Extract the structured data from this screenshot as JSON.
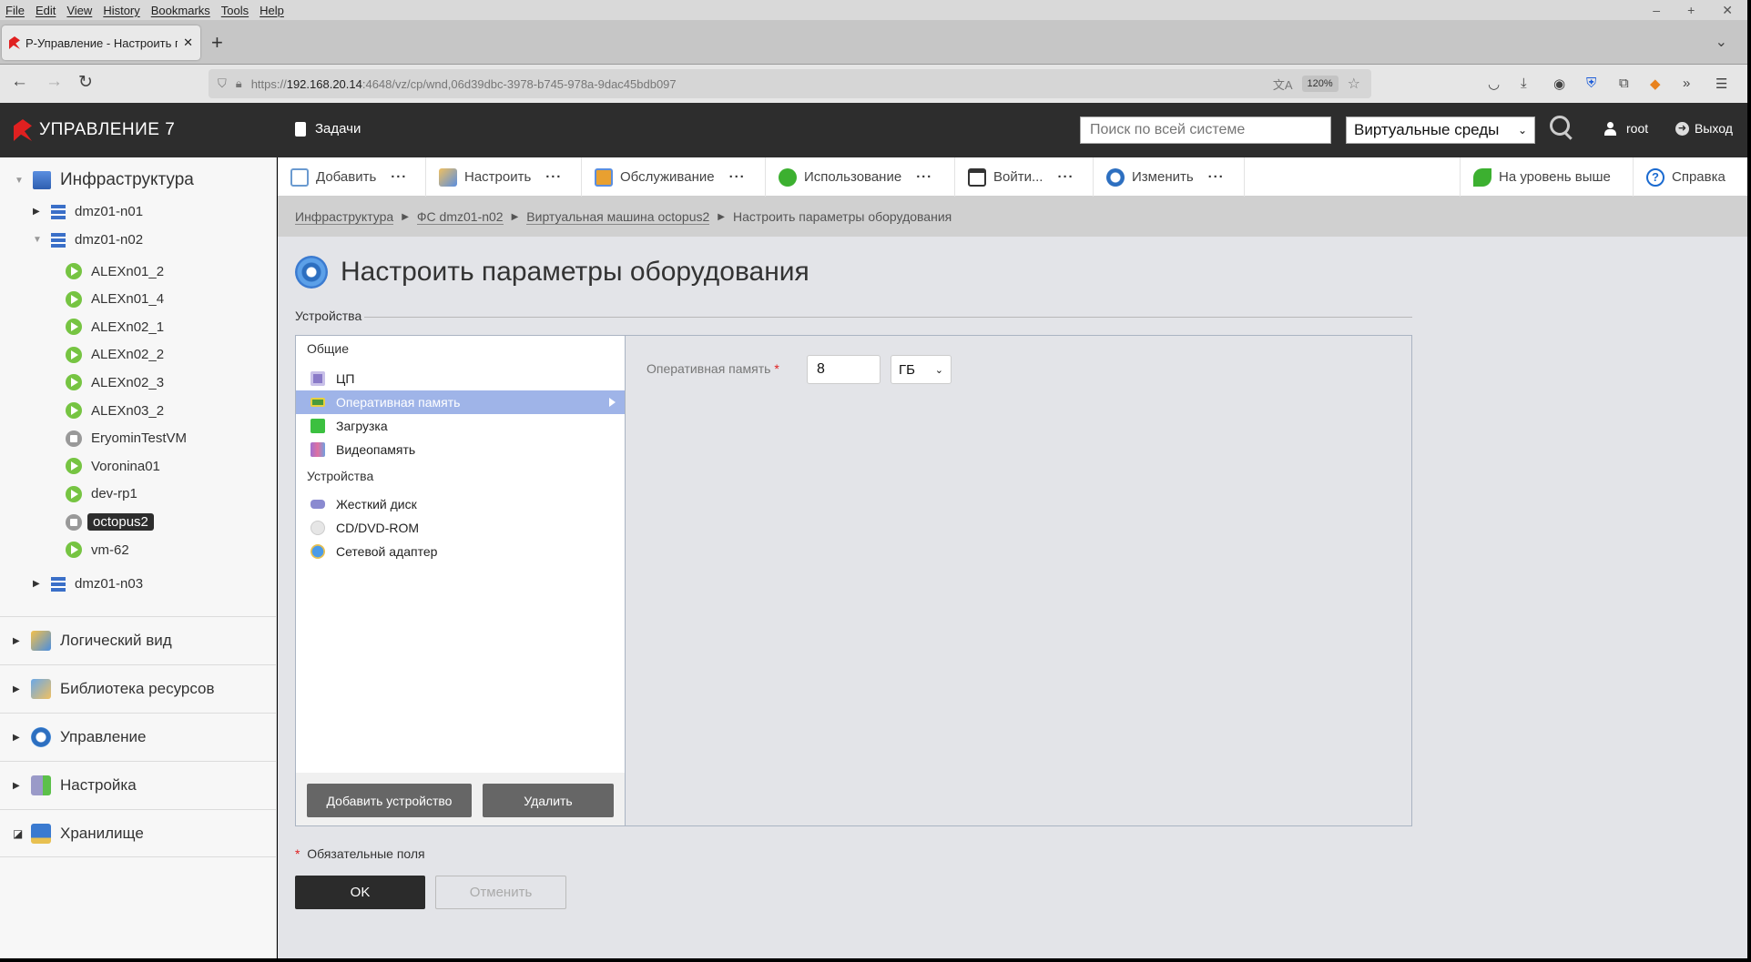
{
  "browser": {
    "menu": [
      "File",
      "Edit",
      "View",
      "History",
      "Bookmarks",
      "Tools",
      "Help"
    ],
    "tab_title": "Р-Управление - Настроить па",
    "url_prefix": "https://",
    "url_host": "192.168.20.14",
    "url_rest": ":4648/vz/cp/wnd,06d39dbc-3978-b745-978a-9dac45bdb097",
    "zoom": "120%"
  },
  "header": {
    "logo": "УПРАВЛЕНИЕ 7",
    "tasks": "Задачи",
    "search_placeholder": "Поиск по всей системе",
    "env_select": "Виртуальные среды",
    "user": "root",
    "logout": "Выход"
  },
  "sidebar": {
    "root": "Инфраструктура",
    "nodes": [
      "dmz01-n01",
      "dmz01-n02",
      "dmz01-n03"
    ],
    "vms": [
      {
        "name": "ALEXn01_2",
        "state": "running"
      },
      {
        "name": "ALEXn01_4",
        "state": "running"
      },
      {
        "name": "ALEXn02_1",
        "state": "running"
      },
      {
        "name": "ALEXn02_2",
        "state": "running"
      },
      {
        "name": "ALEXn02_3",
        "state": "running"
      },
      {
        "name": "ALEXn03_2",
        "state": "running"
      },
      {
        "name": "EryominTestVM",
        "state": "stopped"
      },
      {
        "name": "Voronina01",
        "state": "running"
      },
      {
        "name": "dev-rp1",
        "state": "running"
      },
      {
        "name": "octopus2",
        "state": "stopped"
      },
      {
        "name": "vm-62",
        "state": "running"
      }
    ],
    "sections": [
      "Логический вид",
      "Библиотека ресурсов",
      "Управление",
      "Настройка",
      "Хранилище"
    ]
  },
  "toolbar": {
    "items": [
      "Добавить",
      "Настроить",
      "Обслуживание",
      "Использование",
      "Войти...",
      "Изменить"
    ],
    "up": "На уровень выше",
    "help": "Справка"
  },
  "breadcrumb": [
    "Инфраструктура",
    "ФС dmz01-n02",
    "Виртуальная машина octopus2",
    "Настроить параметры оборудования"
  ],
  "page": {
    "title": "Настроить параметры оборудования",
    "devices_label": "Устройства",
    "groups": [
      "Общие",
      "Устройства"
    ],
    "general": [
      "ЦП",
      "Оперативная память",
      "Загрузка",
      "Видеопамять"
    ],
    "devices": [
      "Жесткий диск",
      "CD/DVD-ROM",
      "Сетевой адаптер"
    ],
    "add_device": "Добавить устройство",
    "remove": "Удалить",
    "field_label": "Оперативная память",
    "required_mark": "*",
    "ram_value": "8",
    "ram_unit": "ГБ",
    "required_note": "Обязательные поля",
    "ok": "OK",
    "cancel": "Отменить"
  },
  "colors": {
    "header": "#2d2d2d",
    "selected_row": "#9fb4e8",
    "running": "#76c442",
    "stopped": "#999999",
    "required": "#e02020"
  }
}
